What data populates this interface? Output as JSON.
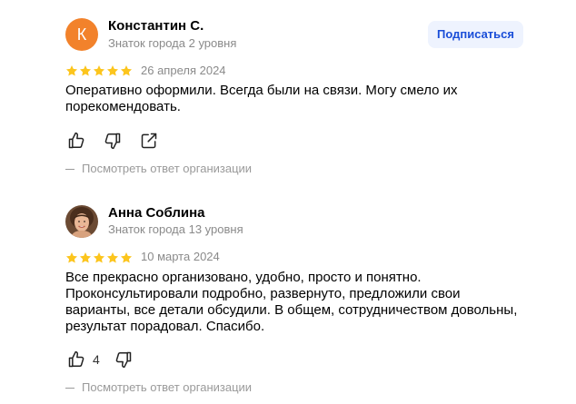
{
  "reviews": [
    {
      "author": {
        "name": "Константин С.",
        "level": "Знаток города 2 уровня",
        "avatar_letter": "К",
        "avatar_color": "#f2822b"
      },
      "subscribe_label": "Подписаться",
      "rating": 5,
      "date": "26 апреля 2024",
      "text": "Оперативно оформили. Всегда были на связи. Могу смело их порекомендовать.",
      "actions": [
        "like-icon",
        "dislike-icon",
        "share-icon"
      ],
      "org_reply_label": "Посмотреть ответ организации"
    },
    {
      "author": {
        "name": "Анна Соблина",
        "level": "Знаток города 13 уровня",
        "avatar_icon": "user-photo-avatar"
      },
      "rating": 5,
      "date": "10 марта 2024",
      "text": "Все прекрасно организовано, удобно, просто и понятно. Проконсультировали подробно, развернуто, предложили свои варианты, все детали обсудили. В общем, сотрудничеством довольны, результат порадовал. Спасибо.",
      "like_count": "4",
      "actions": [
        "like-icon",
        "dislike-icon"
      ],
      "org_reply_label": "Посмотреть ответ организации"
    }
  ],
  "colors": {
    "star": "#fcc51d",
    "subscribe_text": "#1a4ed8",
    "subscribe_bg": "#eef3fe",
    "muted": "#8a8a8a"
  }
}
